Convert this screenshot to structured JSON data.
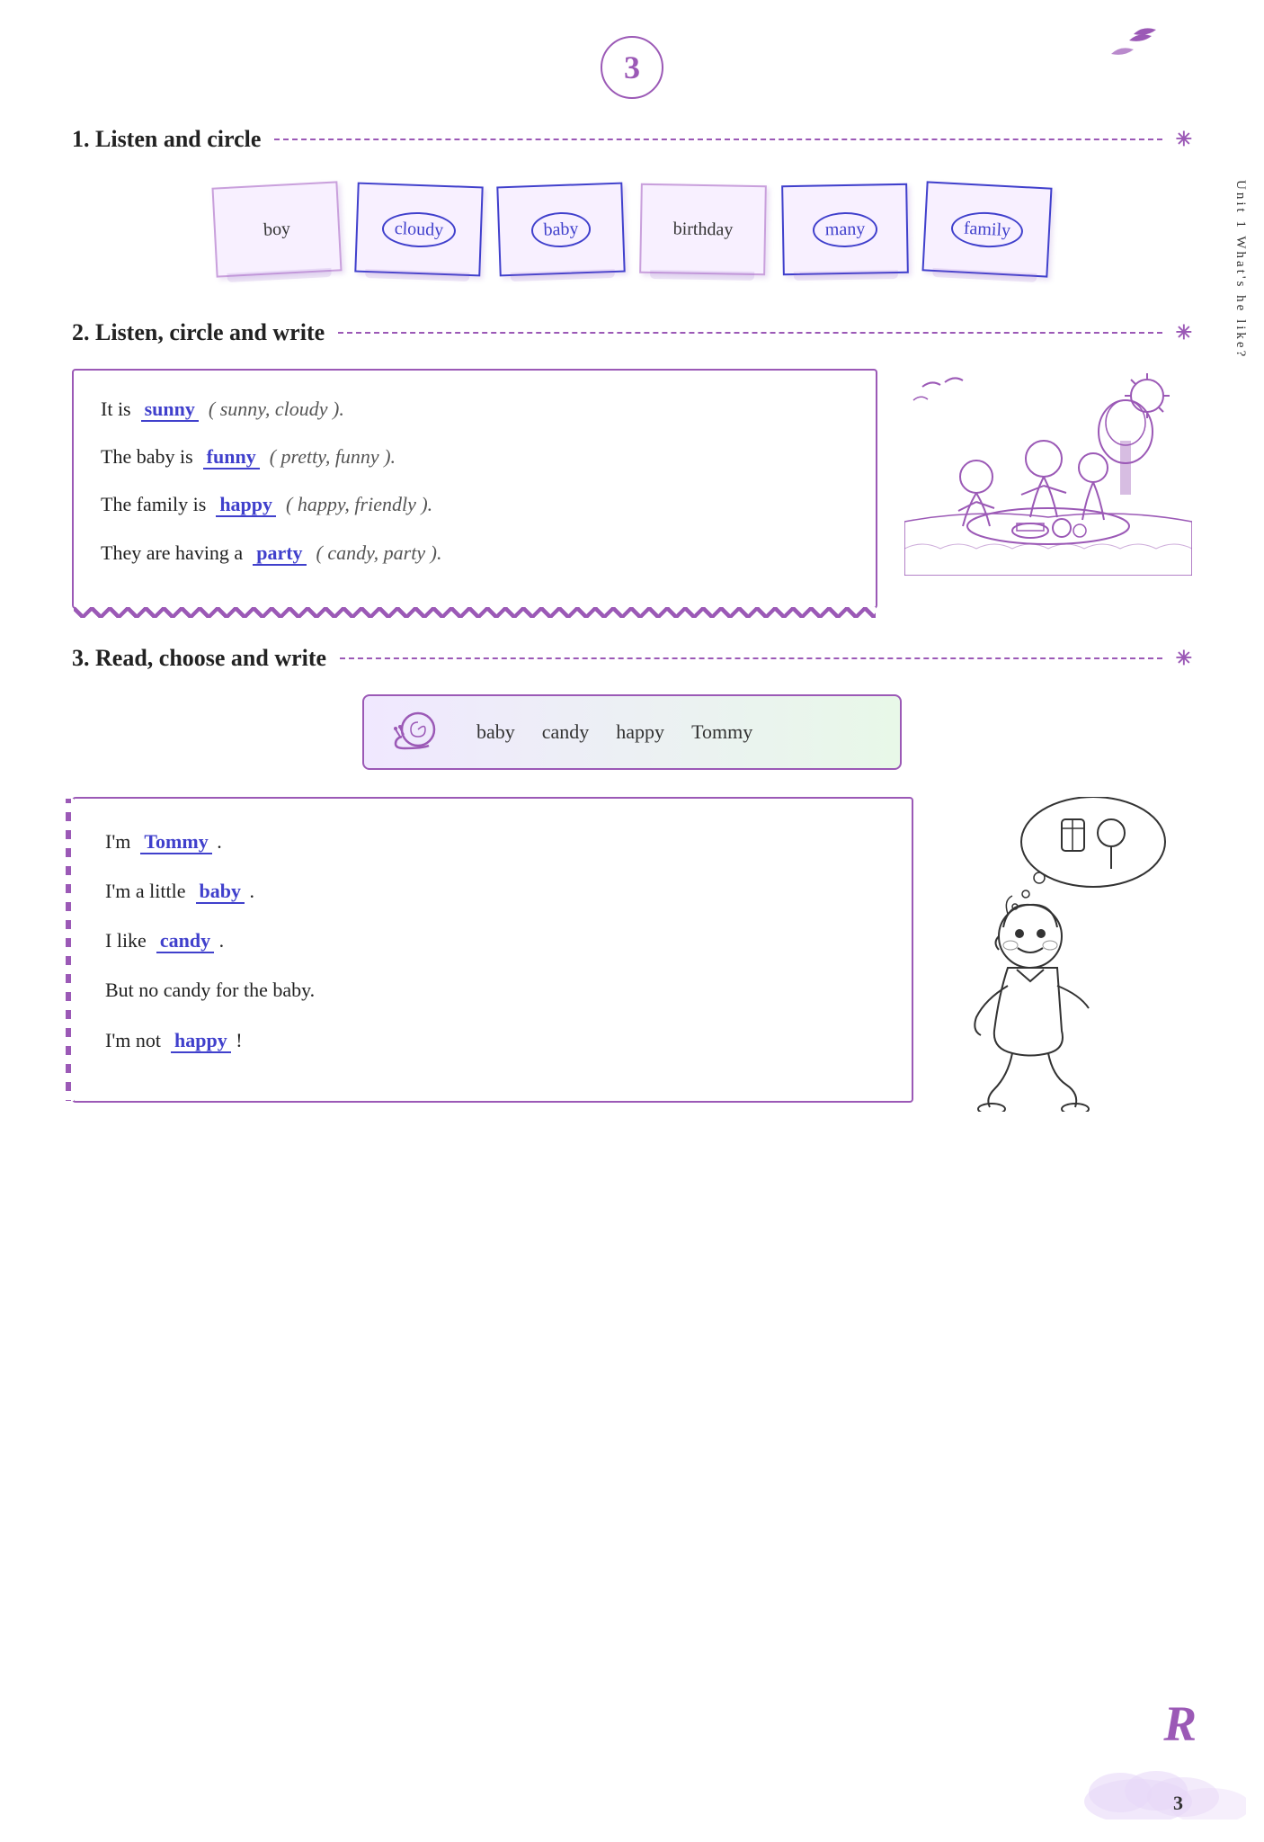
{
  "page": {
    "number": "3",
    "side_label": "Unit 1   What's he like?"
  },
  "section1": {
    "label": "1. Listen and circle",
    "words": [
      {
        "text": "boy",
        "circled": false
      },
      {
        "text": "cloudy",
        "circled": true
      },
      {
        "text": "baby",
        "circled": true
      },
      {
        "text": "birthday",
        "circled": false
      },
      {
        "text": "many",
        "circled": true
      },
      {
        "text": "family",
        "circled": true
      }
    ]
  },
  "section2": {
    "label": "2. Listen, circle and write",
    "lines": [
      {
        "prefix": "It is",
        "answer": "sunny",
        "options": "( sunny, cloudy )."
      },
      {
        "prefix": "The baby is",
        "answer": "funny",
        "options": "( pretty, funny )."
      },
      {
        "prefix": "The family is",
        "answer": "happy",
        "options": "( happy, friendly )."
      },
      {
        "prefix": "They are having a",
        "answer": "party",
        "options": "( candy, party )."
      }
    ]
  },
  "section3": {
    "label": "3. Read, choose and write",
    "word_bank": [
      "baby",
      "candy",
      "happy",
      "Tommy"
    ],
    "story_lines": [
      {
        "prefix": "I'm",
        "answer": "Tommy",
        "suffix": "."
      },
      {
        "prefix": "I'm a little",
        "answer": "baby",
        "suffix": "."
      },
      {
        "prefix": "I like",
        "answer": "candy",
        "suffix": "."
      },
      {
        "prefix": "But no candy for the baby.",
        "answer": "",
        "suffix": ""
      },
      {
        "prefix": "I'm not",
        "answer": "happy",
        "suffix": "!"
      }
    ]
  },
  "icons": {
    "star": "✳",
    "snail": "🐌",
    "bird1": "🐦",
    "bird2": "🐦"
  }
}
